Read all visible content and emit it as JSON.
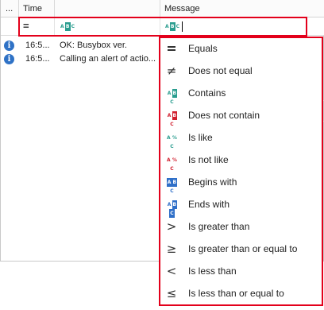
{
  "columns": {
    "ellipsis": "...",
    "time": "Time",
    "message": "Message"
  },
  "filter_row": {
    "first_glyph": "=",
    "time_glyph": "ABC",
    "message_glyph": "ABC"
  },
  "rows": [
    {
      "time": "16:5...",
      "message": "OK: Busybox ver."
    },
    {
      "time": "16:5...",
      "message": "Calling an alert of actio..."
    }
  ],
  "operators": [
    {
      "label": "Equals",
      "icon": "equals-icon",
      "glyph": "═"
    },
    {
      "label": "Does not equal",
      "icon": "not-equal-icon",
      "glyph": "≠"
    },
    {
      "label": "Contains",
      "icon": "contains-abc-icon",
      "glyph": "ABC"
    },
    {
      "label": "Does not contain",
      "icon": "does-not-contain-abc-icon",
      "glyph": "ABC"
    },
    {
      "label": "Is like",
      "icon": "like-icon",
      "glyph": "A%C"
    },
    {
      "label": "Is not like",
      "icon": "not-like-icon",
      "glyph": "A%C"
    },
    {
      "label": "Begins with",
      "icon": "begins-with-icon",
      "glyph": "ABC"
    },
    {
      "label": "Ends with",
      "icon": "ends-with-icon",
      "glyph": "ABC"
    },
    {
      "label": "Is greater than",
      "icon": "greater-than-icon",
      "glyph": ">"
    },
    {
      "label": "Is greater than or equal to",
      "icon": "greater-equal-icon",
      "glyph": "≥"
    },
    {
      "label": "Is less than",
      "icon": "less-than-icon",
      "glyph": "<"
    },
    {
      "label": "Is less than or equal to",
      "icon": "less-equal-icon",
      "glyph": "≤"
    }
  ],
  "colors": {
    "highlight_red": "#e3001b",
    "teal": "#2a9d8f",
    "red": "#d11f2e",
    "blue": "#2f6fc8",
    "info_blue": "#2f72c6"
  }
}
